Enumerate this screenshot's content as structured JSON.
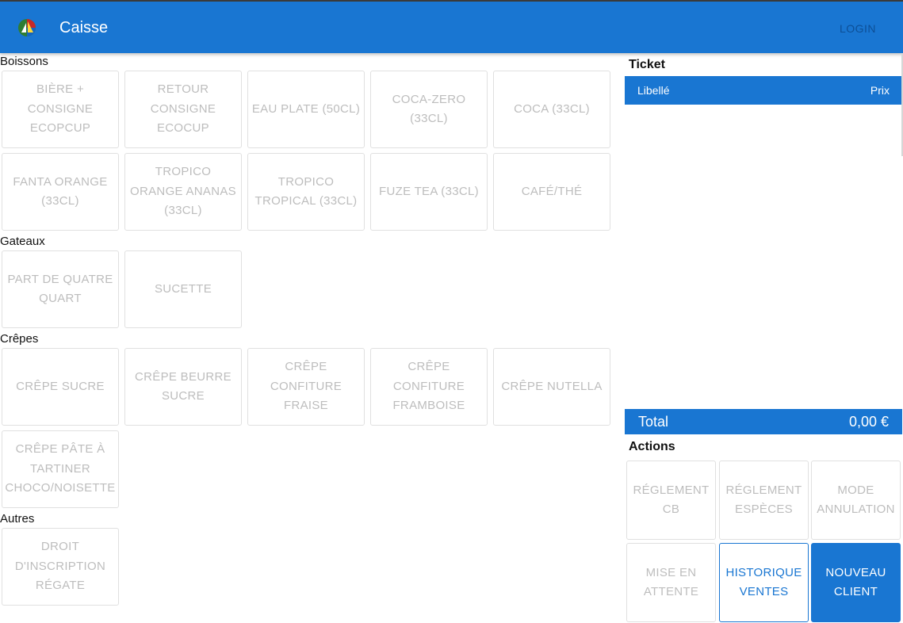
{
  "app": {
    "title": "Caisse",
    "login_label": "LOGIN"
  },
  "sections": [
    {
      "title": "Boissons",
      "items": [
        "BIÈRE + CONSIGNE ECOPCUP",
        "RETOUR CONSIGNE ECOCUP",
        "EAU PLATE (50CL)",
        "COCA-ZERO (33CL)",
        "COCA (33CL)",
        "FANTA ORANGE (33CL)",
        "TROPICO ORANGE ANANAS (33CL)",
        "TROPICO TROPICAL (33CL)",
        "FUZE TEA (33CL)",
        "CAFÉ/THÉ"
      ]
    },
    {
      "title": "Gateaux",
      "items": [
        "PART DE QUATRE QUART",
        "SUCETTE"
      ]
    },
    {
      "title": "Crêpes",
      "items": [
        "CRÊPE SUCRE",
        "CRÊPE BEURRE SUCRE",
        "CRÊPE CONFITURE FRAISE",
        "CRÊPE CONFITURE FRAMBOISE",
        "CRÊPE NUTELLA",
        "CRÊPE PÂTE À TARTINER CHOCO/NOISETTE"
      ]
    },
    {
      "title": "Autres",
      "items": [
        "DROIT D'INSCRIPTION RÉGATE"
      ]
    }
  ],
  "ticket": {
    "title": "Ticket",
    "col_label": "Libellé",
    "col_price": "Prix",
    "total_label": "Total",
    "total_value": "0,00 €"
  },
  "actions": {
    "title": "Actions",
    "reglement_cb": "RÉGLEMENT CB",
    "reglement_especes": "RÉGLEMENT ESPÈCES",
    "mode_annulation": "MODE ANNULATION",
    "mise_en_attente": "MISE EN ATTENTE",
    "historique_ventes": "HISTORIQUE VENTES",
    "nouveau_client": "NOUVEAU CLIENT"
  },
  "colors": {
    "primary": "#1976d2",
    "disabled_text": "#bdbdbd",
    "border": "#e0e0e0"
  }
}
